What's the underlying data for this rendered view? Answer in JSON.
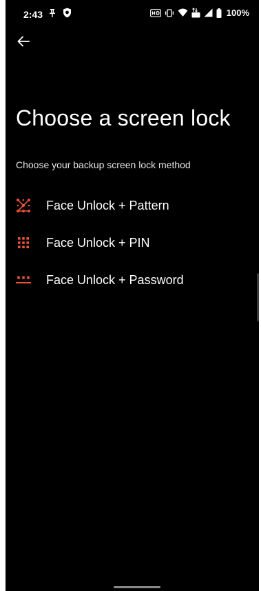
{
  "status_bar": {
    "time": "2:43",
    "battery_percent": "100%",
    "icons_left": [
      "pin-icon",
      "shield-icon"
    ],
    "icons_right": [
      "hd-icon",
      "vibrate-icon",
      "wifi-icon",
      "data-icon",
      "signal-icon",
      "battery-icon"
    ]
  },
  "header": {
    "back_icon": "arrow-left-icon",
    "title": "Choose a screen lock",
    "subtitle": "Choose your backup screen lock method"
  },
  "options": [
    {
      "label": "Face Unlock + Pattern",
      "icon": "pattern-icon"
    },
    {
      "label": "Face Unlock + PIN",
      "icon": "pin-grid-icon"
    },
    {
      "label": "Face Unlock + Password",
      "icon": "password-icon"
    }
  ],
  "colors": {
    "background": "#000000",
    "text": "#ffffff",
    "accent": "#e8533a"
  }
}
